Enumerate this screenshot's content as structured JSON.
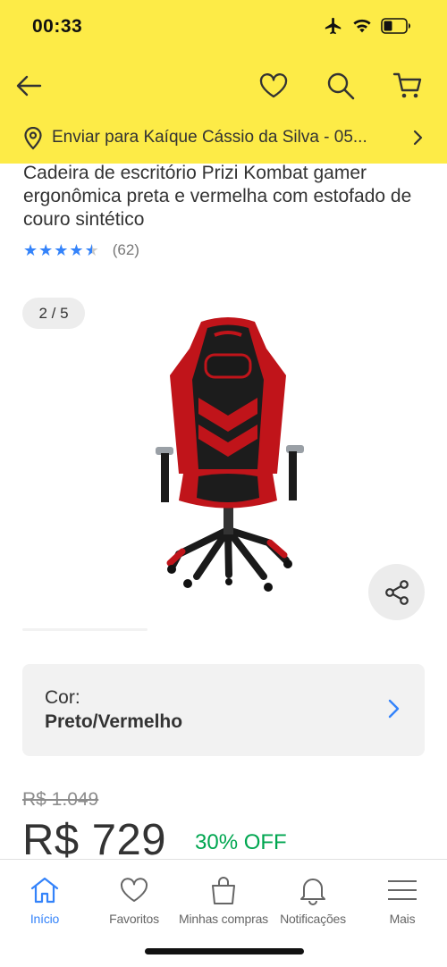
{
  "status_bar": {
    "time": "00:33"
  },
  "header": {
    "address": "Enviar para Kaíque Cássio da Silva - 05..."
  },
  "product": {
    "title": "Cadeira de escritório Prizi Kombat gamer ergonômica  preta e vermelha com estofado de couro sintético",
    "rating_stars": "★★★★★",
    "rating_value": 4.5,
    "rating_count": "(62)",
    "image_counter": "2 / 5",
    "color_label": "Cor:",
    "color_value": "Preto/Vermelho",
    "old_price": "R$ 1.049",
    "price": "R$ 729",
    "discount": "30% OFF"
  },
  "tabbar": {
    "items": [
      {
        "label": "Início",
        "icon": "home-icon",
        "active": true
      },
      {
        "label": "Favoritos",
        "icon": "heart-icon",
        "active": false
      },
      {
        "label": "Minhas compras",
        "icon": "shopping-bag-icon",
        "active": false
      },
      {
        "label": "Notificações",
        "icon": "bell-icon",
        "active": false
      },
      {
        "label": "Mais",
        "icon": "menu-icon",
        "active": false
      }
    ]
  },
  "colors": {
    "header_yellow": "#fdeb47",
    "accent_blue": "#3483fa",
    "discount_green": "#00a650"
  }
}
